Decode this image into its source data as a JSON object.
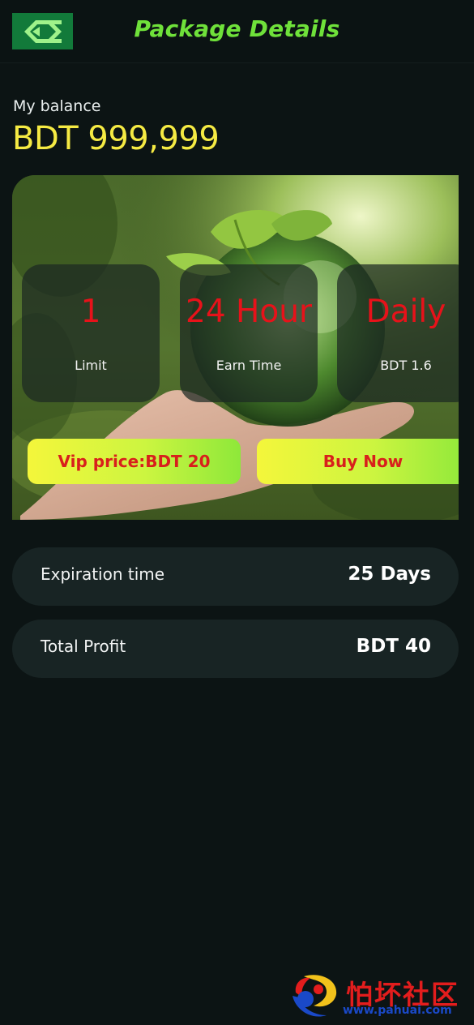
{
  "header": {
    "title": "Package Details",
    "back_icon": "back-arrow-icon"
  },
  "balance": {
    "label": "My balance",
    "value": "BDT 999,999"
  },
  "stats": [
    {
      "value": "1",
      "label": "Limit"
    },
    {
      "value": "24 Hour",
      "label": "Earn Time"
    },
    {
      "value": "Daily",
      "label": "BDT 1.6"
    }
  ],
  "actions": {
    "vip_price_label": "Vip price:BDT 20",
    "buy_label": "Buy Now"
  },
  "details": [
    {
      "label": "Expiration time",
      "value": "25 Days"
    },
    {
      "label": "Total Profit",
      "value": "BDT 40"
    }
  ],
  "watermark": {
    "text": "怕坏社区",
    "url": "www.pahuai.com"
  },
  "colors": {
    "accent_green": "#6fe13a",
    "balance_yellow": "#f5ea43",
    "stat_red": "#e7121a",
    "button_text_red": "#d8201c",
    "background": "#0c1414",
    "row_background": "#182424"
  }
}
